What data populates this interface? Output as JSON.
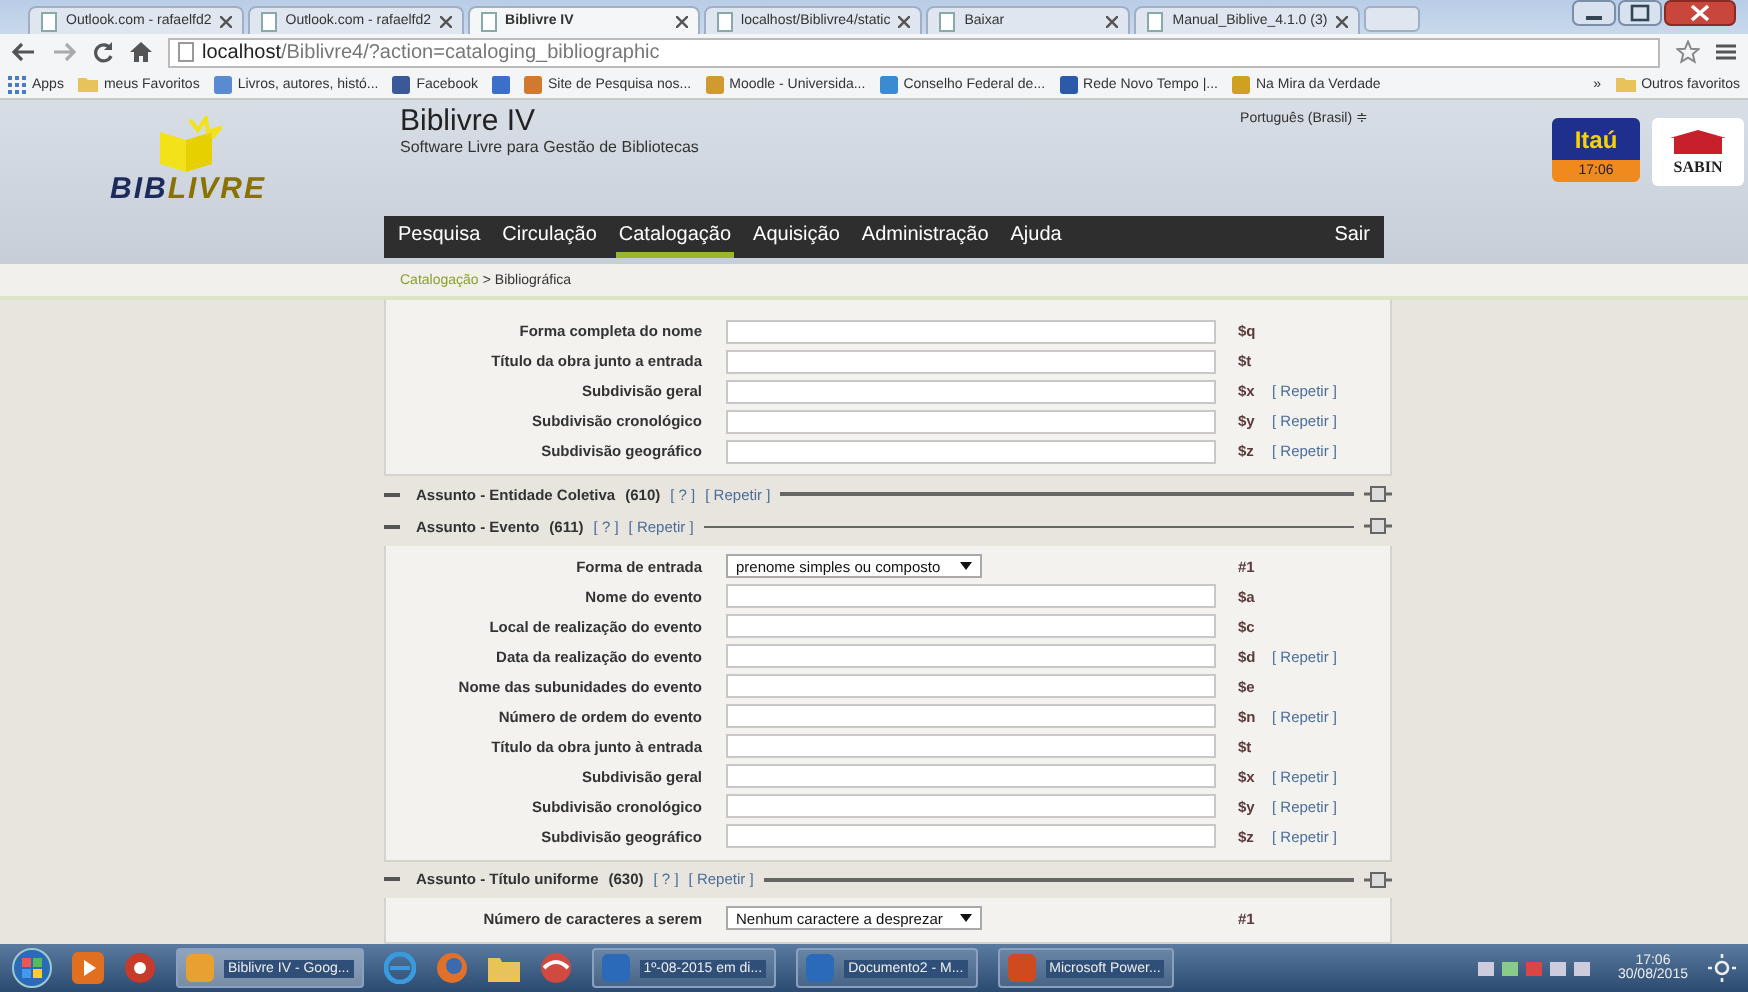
{
  "browser": {
    "tabs": [
      {
        "title": "Outlook.com - rafaelfd2",
        "selected": false
      },
      {
        "title": "Outlook.com - rafaelfd2",
        "selected": false
      },
      {
        "title": "Biblivre IV",
        "selected": true
      },
      {
        "title": "localhost/Biblivre4/static",
        "selected": false
      },
      {
        "title": "Baixar",
        "selected": false
      },
      {
        "title": "Manual_Biblive_4.1.0 (3)",
        "selected": false
      }
    ],
    "url": {
      "host": "localhost",
      "path": "/Biblivre4/?action=cataloging_bibliographic"
    },
    "bookmarks": [
      {
        "kind": "link",
        "label": "Apps"
      },
      {
        "kind": "link",
        "label": "meus Favoritos"
      },
      {
        "kind": "link",
        "label": "Livros, autores, histó..."
      },
      {
        "kind": "link",
        "label": "Facebook"
      },
      {
        "kind": "icon"
      },
      {
        "kind": "link",
        "label": "Site de Pesquisa nos..."
      },
      {
        "kind": "link",
        "label": "Moodle - Universida..."
      },
      {
        "kind": "link",
        "label": "Conselho Federal de..."
      },
      {
        "kind": "link",
        "label": "Rede Novo Tempo |..."
      },
      {
        "kind": "link",
        "label": "Na Mira da Verdade"
      }
    ],
    "more_bookmarks": "»",
    "other_bookmarks": "Outros favoritos"
  },
  "header": {
    "logo": [
      "BIB",
      "LIVRE"
    ],
    "title": "Biblivre IV",
    "subtitle": "Software Livre para Gestão de Bibliotecas",
    "language": "Português (Brasil) ≑",
    "menu": [
      {
        "label": "Pesquisa",
        "selected": false
      },
      {
        "label": "Circulação",
        "selected": false
      },
      {
        "label": "Catalogação",
        "selected": true
      },
      {
        "label": "Aquisição",
        "selected": false
      },
      {
        "label": "Administração",
        "selected": false
      },
      {
        "label": "Ajuda",
        "selected": false
      }
    ],
    "logout": "Sair",
    "bank": {
      "name": "Itaú",
      "time": "17:06"
    },
    "sponsor": "SABIN"
  },
  "breadcrumb": {
    "link": "Catalogação",
    "separator": ">",
    "current": "Bibliográfica"
  },
  "sections": [
    {
      "rows": [
        {
          "kind": "text",
          "label": "Forma completa do nome",
          "code": "$q"
        },
        {
          "kind": "text",
          "label": "Título da obra junto a entrada",
          "code": "$t"
        },
        {
          "kind": "text",
          "label": "Subdivisão geral",
          "code": "$x",
          "repeat": "[ Repetir ]"
        },
        {
          "kind": "text",
          "label": "Subdivisão cronológico",
          "code": "$y",
          "repeat": "[ Repetir ]"
        },
        {
          "kind": "text",
          "label": "Subdivisão geográfico",
          "code": "$z",
          "repeat": "[ Repetir ]"
        }
      ]
    },
    {
      "title": "Assunto - Entidade Coletiva",
      "tag": "(610)",
      "help": "[ ? ]",
      "repeat": "[ Repetir ]"
    },
    {
      "title": "Assunto - Evento",
      "tag": "(611)",
      "help": "[ ? ]",
      "repeat": "[ Repetir ]",
      "rows": [
        {
          "kind": "select",
          "label": "Forma de entrada",
          "value": "prenome simples ou composto",
          "code": "#1"
        },
        {
          "kind": "text",
          "label": "Nome do evento",
          "code": "$a"
        },
        {
          "kind": "text",
          "label": "Local de realização do evento",
          "code": "$c"
        },
        {
          "kind": "text",
          "label": "Data da realização do evento",
          "code": "$d",
          "repeat": "[ Repetir ]"
        },
        {
          "kind": "text",
          "label": "Nome das subunidades do evento",
          "code": "$e"
        },
        {
          "kind": "text",
          "label": "Número de ordem do evento",
          "code": "$n",
          "repeat": "[ Repetir ]"
        },
        {
          "kind": "text",
          "label": "Título da obra junto à entrada",
          "code": "$t"
        },
        {
          "kind": "text",
          "label": "Subdivisão geral",
          "code": "$x",
          "repeat": "[ Repetir ]"
        },
        {
          "kind": "text",
          "label": "Subdivisão cronológico",
          "code": "$y",
          "repeat": "[ Repetir ]"
        },
        {
          "kind": "text",
          "label": "Subdivisão geográfico",
          "code": "$z",
          "repeat": "[ Repetir ]"
        }
      ]
    },
    {
      "title": "Assunto - Título uniforme",
      "tag": "(630)",
      "help": "[ ? ]",
      "repeat": "[ Repetir ]",
      "rows": [
        {
          "kind": "select",
          "label": "Número de caracteres a serem",
          "value": "Nenhum caractere a desprezar",
          "code": "#1"
        }
      ]
    }
  ],
  "taskbar": {
    "windows": [
      {
        "title": "Biblivre IV - Goog...",
        "selected": true
      },
      {
        "title": "1º-08-2015 em di...",
        "selected": false
      },
      {
        "title": "Documento2 - M...",
        "selected": false
      },
      {
        "title": "Microsoft Power...",
        "selected": false
      }
    ],
    "time": "17:06",
    "date": "30/08/2015"
  }
}
